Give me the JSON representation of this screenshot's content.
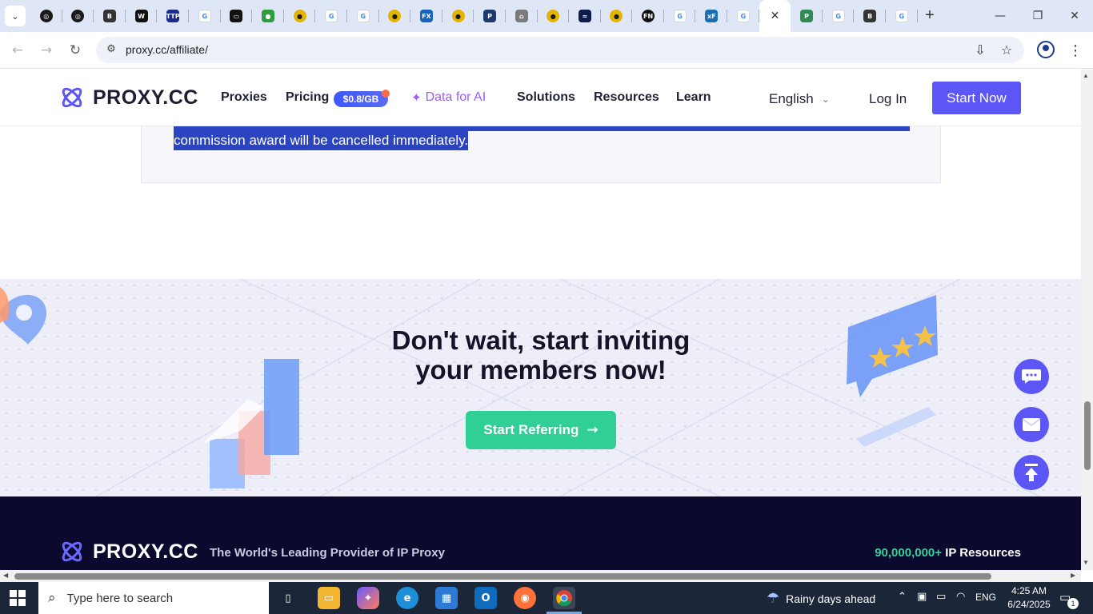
{
  "browser": {
    "tabs": [
      {
        "icon": "openai-icon",
        "color": "#1a1a1a",
        "glyph": "◎"
      },
      {
        "icon": "openai-icon",
        "color": "#1a1a1a",
        "glyph": "◎"
      },
      {
        "icon": "b-icon",
        "color": "#333333",
        "glyph": "B"
      },
      {
        "icon": "w-icon",
        "color": "#111111",
        "glyph": "W"
      },
      {
        "icon": "ttp-icon",
        "color": "#1b2a8c",
        "glyph": "TTP"
      },
      {
        "icon": "google-icon",
        "color": "#ffffff",
        "glyph": "G"
      },
      {
        "icon": "film-icon",
        "color": "#111111",
        "glyph": "▭"
      },
      {
        "icon": "globe-icon",
        "color": "#2e9d3e",
        "glyph": "●"
      },
      {
        "icon": "coin-icon",
        "color": "#e3b400",
        "glyph": "●"
      },
      {
        "icon": "google-icon",
        "color": "#ffffff",
        "glyph": "G"
      },
      {
        "icon": "google-icon",
        "color": "#ffffff",
        "glyph": "G"
      },
      {
        "icon": "coin-icon",
        "color": "#e3b400",
        "glyph": "●"
      },
      {
        "icon": "fx-icon",
        "color": "#1565c0",
        "glyph": "FX"
      },
      {
        "icon": "coin-icon",
        "color": "#e3b400",
        "glyph": "●"
      },
      {
        "icon": "p-icon",
        "color": "#1e3a6e",
        "glyph": "P"
      },
      {
        "icon": "house-icon",
        "color": "#7a7a7a",
        "glyph": "⌂"
      },
      {
        "icon": "coin-icon",
        "color": "#e3b400",
        "glyph": "●"
      },
      {
        "icon": "wave-icon",
        "color": "#0d1b4a",
        "glyph": "≈"
      },
      {
        "icon": "coin-icon",
        "color": "#e3b400",
        "glyph": "●"
      },
      {
        "icon": "fn-icon",
        "color": "#111111",
        "glyph": "FN"
      },
      {
        "icon": "google-icon",
        "color": "#ffffff",
        "glyph": "G"
      },
      {
        "icon": "xf-icon",
        "color": "#1a6fb5",
        "glyph": "xF"
      },
      {
        "icon": "google-icon",
        "color": "#ffffff",
        "glyph": "G"
      },
      {
        "icon": "close-icon",
        "color": "#ffffff",
        "glyph": "✕",
        "active": true
      },
      {
        "icon": "jp-icon",
        "color": "#2e8b57",
        "glyph": "P"
      },
      {
        "icon": "google-icon",
        "color": "#ffffff",
        "glyph": "G"
      },
      {
        "icon": "b-icon",
        "color": "#333333",
        "glyph": "B"
      },
      {
        "icon": "google-icon",
        "color": "#ffffff",
        "glyph": "G"
      }
    ],
    "url": "proxy.cc/affiliate/"
  },
  "header": {
    "logo_text": "PROXY.CC",
    "nav": {
      "proxies": "Proxies",
      "pricing": "Pricing",
      "pricing_badge": "$0.8/GB",
      "data_for_ai": "Data for AI",
      "solutions": "Solutions",
      "resources": "Resources",
      "learn": "Learn"
    },
    "language": "English",
    "login": "Log In",
    "start_now": "Start Now"
  },
  "terms": {
    "selected_line_2": "commission award will be cancelled immediately."
  },
  "cta": {
    "title_line_1": "Don't wait, start inviting",
    "title_line_2": "your members now!",
    "button": "Start Referring"
  },
  "footer": {
    "logo_text": "PROXY.CC",
    "tagline": "The World's Leading Provider of IP Proxy",
    "ip_count": "90,000,000+",
    "ip_label": " IP Resources"
  },
  "taskbar": {
    "search_placeholder": "Type here to search",
    "weather": "Rainy days ahead",
    "language": "ENG",
    "time": "4:25 AM",
    "date": "6/24/2025",
    "notification_count": "1"
  },
  "colors": {
    "brand": "#5b56f5",
    "cta_green": "#2fcf96",
    "footer_bg": "#0b0a2e",
    "selection": "#2b45c2"
  }
}
